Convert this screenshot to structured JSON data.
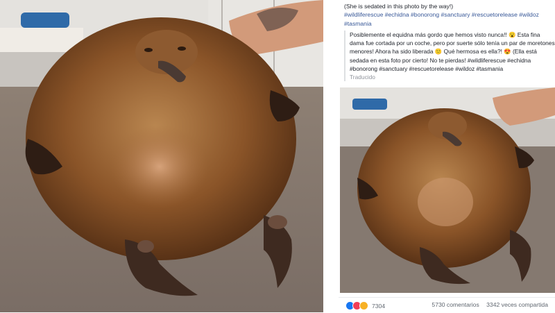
{
  "post": {
    "caption_line": "(She is sedated in this photo by the way!)",
    "hashtags": "#wildliferescue #echidna #bonorong #sanctuary #rescuetorelease #wildoz #tasmania",
    "translation": "Posiblemente el equidna más gordo que hemos visto nunca!! 😮 Esta fina dama fue cortada por un coche, pero por suerte sólo tenía un par de moretones menores! Ahora ha sido liberada 🙂 Qué hermosa es ella?! 😍 (Ella está sedada en esta foto por cierto! No te pierdas! #wildliferescue #echidna #bonorong #sanctuary #rescuetorelease #wildoz #tasmania",
    "translated_label": "Traducido"
  },
  "footer": {
    "reactions_count": "7304",
    "comments": "5730 comentarios",
    "shares": "3342 veces compartida"
  },
  "colors": {
    "link": "#385898",
    "fur_dark": "#5e3417",
    "fur_light": "#b8834c",
    "towel": "#8f8177"
  },
  "icons": [
    "like-icon",
    "love-icon",
    "wow-icon"
  ]
}
